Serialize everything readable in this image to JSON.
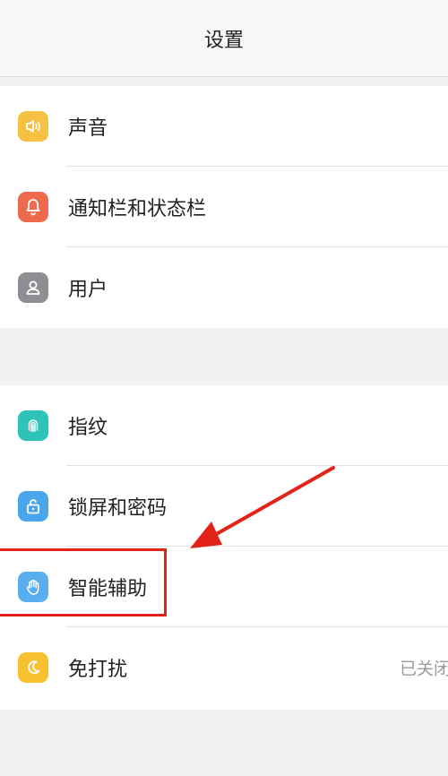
{
  "header": {
    "title": "设置"
  },
  "group1": [
    {
      "label": "声音",
      "icon": "speaker-icon",
      "color": "#f6c042"
    },
    {
      "label": "通知栏和状态栏",
      "icon": "bell-icon",
      "color": "#ee6a4f"
    },
    {
      "label": "用户",
      "icon": "user-icon",
      "color": "#8e8e93"
    }
  ],
  "group2": [
    {
      "label": "指纹",
      "icon": "fingerprint-icon",
      "color": "#2ec3b9"
    },
    {
      "label": "锁屏和密码",
      "icon": "lock-icon",
      "color": "#4aa6ec"
    },
    {
      "label": "智能辅助",
      "icon": "hand-icon",
      "color": "#58aeef"
    },
    {
      "label": "免打扰",
      "icon": "moon-icon",
      "color": "#f7c131",
      "value": "已关闭"
    }
  ],
  "annotation": {
    "highlight_color": "#e2231a"
  }
}
